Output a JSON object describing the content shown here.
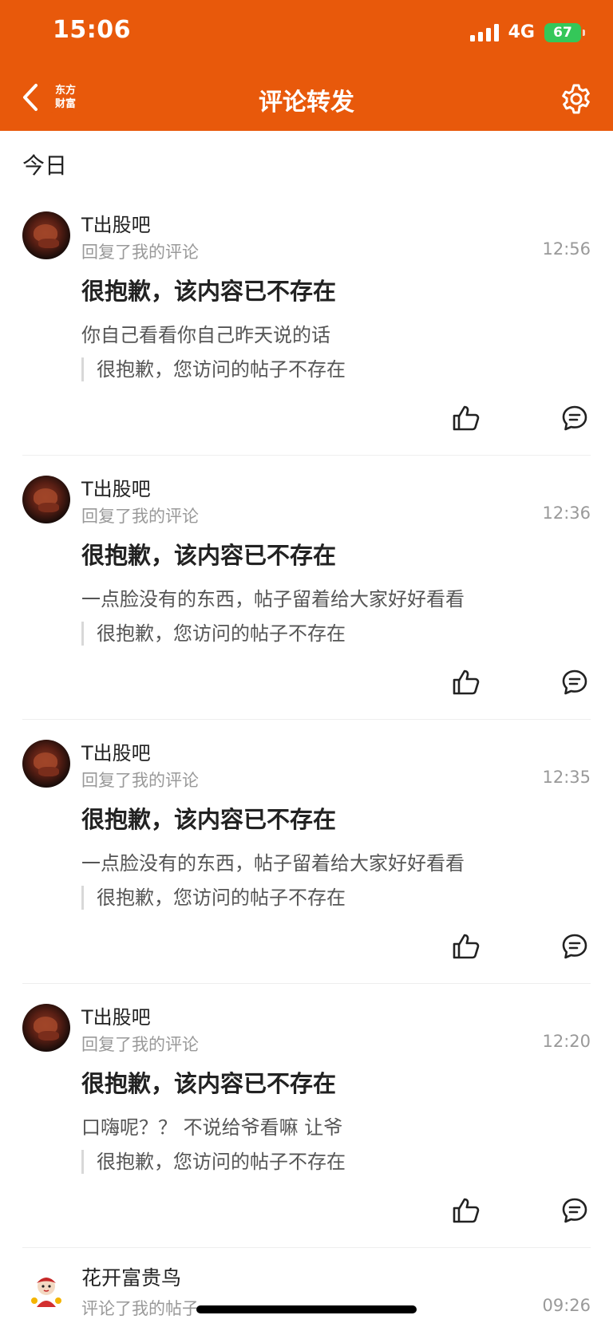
{
  "status_bar": {
    "time": "15:06",
    "network": "4G",
    "battery": "67"
  },
  "nav": {
    "title": "评论转发",
    "logo_line1": "东方",
    "logo_line2": "财富"
  },
  "section": {
    "label": "今日"
  },
  "items": [
    {
      "user": "T出股吧",
      "action": "回复了我的评论",
      "time": "12:56",
      "headline": "很抱歉，该内容已不存在",
      "comment": "你自己看看你自己昨天说的话",
      "quote": "很抱歉，您访问的帖子不存在"
    },
    {
      "user": "T出股吧",
      "action": "回复了我的评论",
      "time": "12:36",
      "headline": "很抱歉，该内容已不存在",
      "comment": "一点脸没有的东西，帖子留着给大家好好看看",
      "quote": "很抱歉，您访问的帖子不存在"
    },
    {
      "user": "T出股吧",
      "action": "回复了我的评论",
      "time": "12:35",
      "headline": "很抱歉，该内容已不存在",
      "comment": "一点脸没有的东西，帖子留着给大家好好看看",
      "quote": "很抱歉，您访问的帖子不存在"
    },
    {
      "user": "T出股吧",
      "action": "回复了我的评论",
      "time": "12:20",
      "headline": "很抱歉，该内容已不存在",
      "comment": "口嗨呢？？ 不说给爷看嘛   让爷",
      "quote": "很抱歉，您访问的帖子不存在"
    }
  ],
  "last_item": {
    "user": "花开富贵鸟",
    "action": "评论了我的帖子",
    "time": "09:26"
  },
  "icons": {
    "back": "chevron-left-icon",
    "settings": "gear-icon",
    "like": "thumbs-up-icon",
    "reply": "comment-bubble-icon"
  },
  "colors": {
    "brand": "#E8590B",
    "battery": "#34C759"
  }
}
